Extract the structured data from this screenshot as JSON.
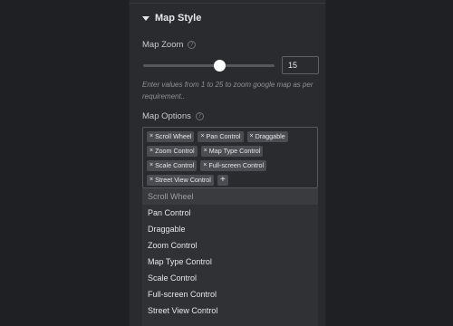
{
  "section": {
    "title": "Map Style"
  },
  "map_zoom": {
    "label": "Map Zoom",
    "value": "15",
    "slider_fraction": 0.58,
    "helper": "Enter values from 1 to 25 to zoom google map as per requirement.."
  },
  "map_options": {
    "label": "Map Options",
    "selected": [
      "Scroll Wheel",
      "Pan Control",
      "Draggable",
      "Zoom Control",
      "Map Type Control",
      "Scale Control",
      "Full-screen Control",
      "Street View Control"
    ],
    "dropdown": [
      "Scroll Wheel",
      "Pan Control",
      "Draggable",
      "Zoom Control",
      "Map Type Control",
      "Scale Control",
      "Full-screen Control",
      "Street View Control"
    ]
  },
  "colors": {
    "background": "#1f2023",
    "panel": "#2a2b2e",
    "tag": "#4a4d52",
    "dropdown": "#303134",
    "text": "#e6e7ea"
  },
  "icons": {
    "section_toggle": "caret-down-icon",
    "help": "question-circle-icon",
    "tag_remove": "close-icon",
    "add": "plus-icon"
  }
}
